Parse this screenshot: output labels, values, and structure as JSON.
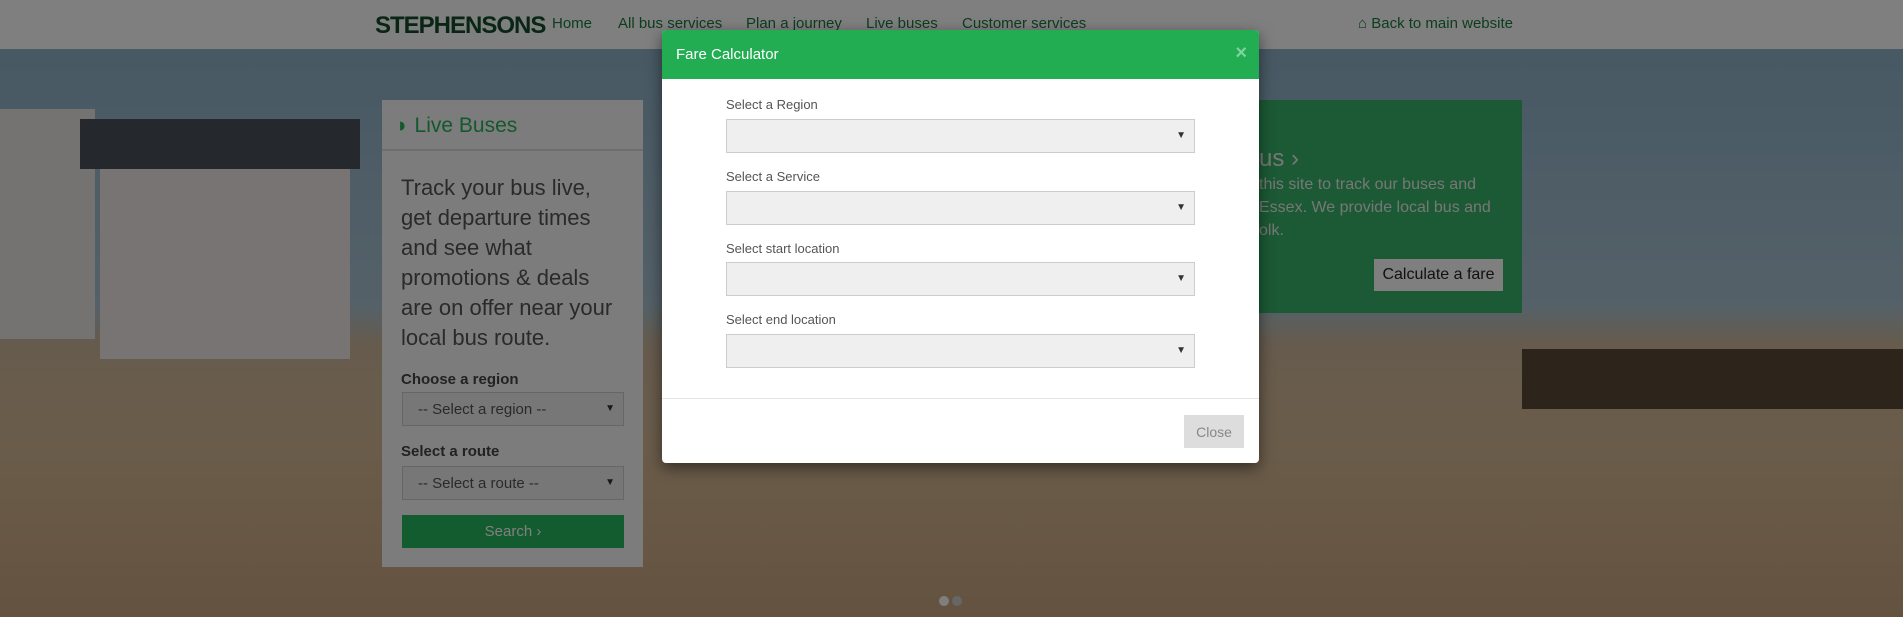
{
  "navbar": {
    "logo": "STEPHENSONS",
    "items": [
      "Home",
      "All bus services",
      "Plan a journey",
      "Live buses",
      "Customer services"
    ],
    "back_link": "Back to main website",
    "back_icon": "home-icon"
  },
  "live_panel": {
    "title": "Live Buses",
    "icon": "rss-icon",
    "description": "Track your bus live, get departure times and see what promotions & deals are on offer near your local bus route.",
    "region_label": "Choose a region",
    "region_value": "-- Select a region --",
    "route_label": "Select a route",
    "route_value": "-- Select a route --",
    "search_label": "Search ›"
  },
  "promo_panel": {
    "title_fragment": "us ›",
    "lines": [
      "this site to track our buses and",
      "Essex. We provide local bus and",
      "olk."
    ],
    "calc_button": "Calculate a fare"
  },
  "modal": {
    "title": "Fare Calculator",
    "close_x": "×",
    "fields": [
      {
        "label": "Select a Region",
        "value": ""
      },
      {
        "label": "Select a Service",
        "value": ""
      },
      {
        "label": "Select start location",
        "value": ""
      },
      {
        "label": "Select end location",
        "value": ""
      }
    ],
    "close_button": "Close",
    "arrow": "▼"
  },
  "colors": {
    "brand_green": "#22ad52",
    "dark_green": "#134d2a"
  }
}
